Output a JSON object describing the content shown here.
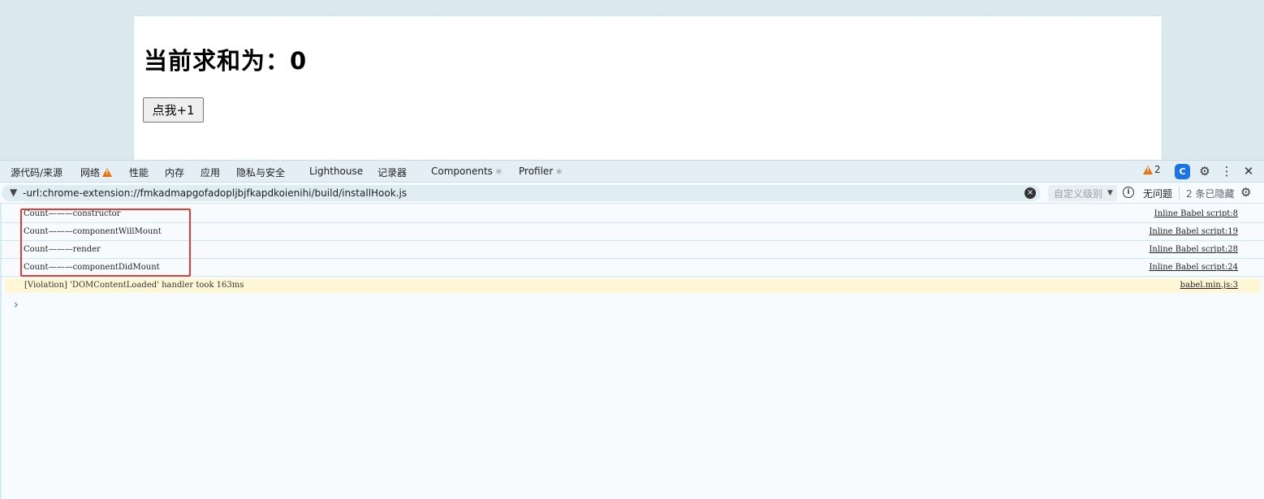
{
  "page": {
    "heading": "当前求和为：0",
    "button_label": "点我+1"
  },
  "devtools": {
    "tabs": [
      {
        "label": "源代码/来源"
      },
      {
        "label": "网络"
      },
      {
        "label": "性能"
      },
      {
        "label": "内存"
      },
      {
        "label": "应用"
      },
      {
        "label": "隐私与安全"
      },
      {
        "label": "Lighthouse"
      },
      {
        "label": "记录器"
      },
      {
        "label": "Components"
      },
      {
        "label": "Profiler"
      }
    ],
    "warning_count": "2",
    "filter": {
      "value": "-url:chrome-extension://fmkadmapgofadopljbjfkapdkoienihi/build/installHook.js",
      "level_placeholder": "自定义级别",
      "issues_label": "无问题",
      "hidden_label": "2 条已隐藏"
    },
    "console": {
      "rows": [
        {
          "message": "Count———constructor",
          "source": "Inline Babel script:8"
        },
        {
          "message": "Count———componentWillMount",
          "source": "Inline Babel script:19"
        },
        {
          "message": "Count———render",
          "source": "Inline Babel script:28"
        },
        {
          "message": "Count———componentDidMount",
          "source": "Inline Babel script:24"
        }
      ],
      "warning": {
        "message": "[Violation] 'DOMContentLoaded' handler took 163ms",
        "source": "babel.min.js:3"
      },
      "prompt_glyph": "›"
    }
  },
  "colors": {
    "accent": "#1a73e8",
    "warning": "#e8710a",
    "highlight": "#e53935",
    "violation_bg": "#fff7d6"
  }
}
